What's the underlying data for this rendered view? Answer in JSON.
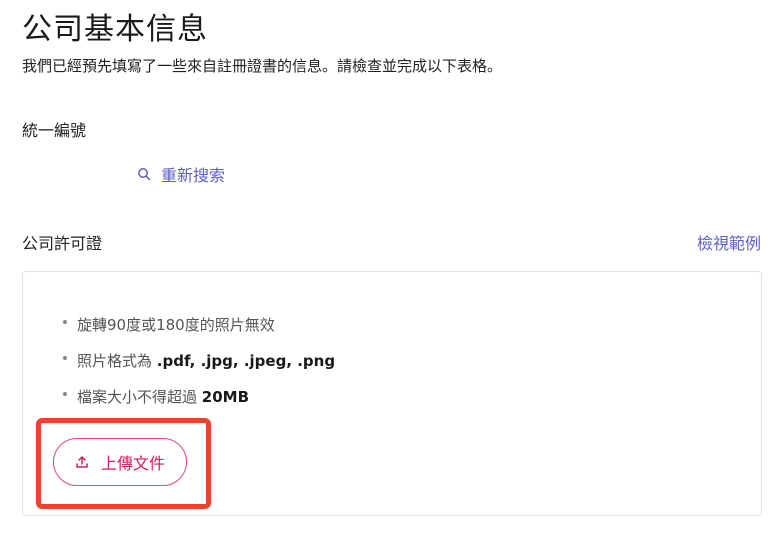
{
  "header": {
    "title": "公司基本信息",
    "subtitle": "我們已經預先填寫了一些來自註冊證書的信息。請檢查並完成以下表格。"
  },
  "tax_id": {
    "label": "統一編號",
    "research_label": "重新搜索"
  },
  "license": {
    "label": "公司許可證",
    "example_link": "檢視範例",
    "rules": [
      {
        "text": "旋轉90度或180度的照片無效",
        "bold": ""
      },
      {
        "text": "照片格式為 ",
        "bold": ".pdf, .jpg, .jpeg, .png"
      },
      {
        "text": "檔案大小不得超過 ",
        "bold": "20MB"
      }
    ],
    "upload_label": "上傳文件"
  },
  "colors": {
    "link": "#5b5fc7",
    "accent": "#d81b60",
    "highlight": "#e8452c"
  },
  "icons": {
    "research": "search-icon",
    "upload": "upload-icon"
  }
}
